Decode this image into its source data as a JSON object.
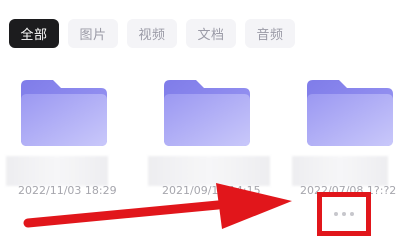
{
  "tabs": [
    {
      "label": "全部",
      "active": true
    },
    {
      "label": "图片",
      "active": false
    },
    {
      "label": "视频",
      "active": false
    },
    {
      "label": "文档",
      "active": false
    },
    {
      "label": "音频",
      "active": false
    }
  ],
  "files": [
    {
      "type": "folder",
      "date": "2022/11/03 18:29"
    },
    {
      "type": "folder",
      "date": "2021/09/17 14:15"
    },
    {
      "type": "folder",
      "date": "2022/07/08 1?:?2"
    }
  ],
  "more_button": {
    "icon": "more-horizontal-icon"
  },
  "annotation": {
    "color": "#e1161b"
  },
  "colors": {
    "active_tab": "#1c1c1e",
    "folder_back": "#8b88ee",
    "folder_front": "#b2b0f7"
  }
}
